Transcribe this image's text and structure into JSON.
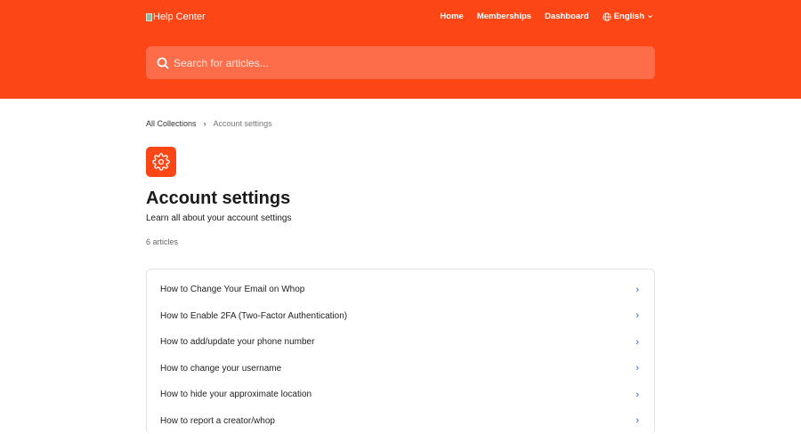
{
  "header": {
    "logo_alt": "Help Center",
    "nav": [
      "Home",
      "Memberships",
      "Dashboard"
    ],
    "language": "English"
  },
  "search": {
    "placeholder": "Search for articles..."
  },
  "breadcrumb": {
    "root": "All Collections",
    "current": "Account settings"
  },
  "collection": {
    "title": "Account settings",
    "description": "Learn all about your account settings",
    "count": "6 articles"
  },
  "articles": [
    "How to Change Your Email on Whop",
    "How to Enable 2FA (Two-Factor Authentication)",
    "How to add/update your phone number",
    "How to change your username",
    "How to hide your approximate location",
    "How to report a creator/whop"
  ],
  "colors": {
    "brand": "#fc4616"
  }
}
